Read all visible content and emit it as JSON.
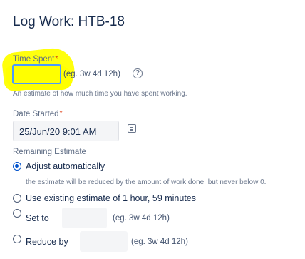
{
  "dialog": {
    "title": "Log Work: HTB-18"
  },
  "time_spent": {
    "label": "Time Spent",
    "required_mark": "*",
    "value": "",
    "hint": "(eg. 3w 4d 12h)",
    "help_glyph": "?",
    "description": "An estimate of how much time you have spent working."
  },
  "date_started": {
    "label": "Date Started",
    "required_mark": "*",
    "value": "25/Jun/20 9:01 AM"
  },
  "remaining_estimate": {
    "label": "Remaining Estimate",
    "options": [
      {
        "label": "Adjust automatically",
        "checked": true
      },
      {
        "label": "Use existing estimate of 1 hour, 59 minutes",
        "checked": false
      },
      {
        "label": "Set to",
        "checked": false,
        "hint": "(eg. 3w 4d 12h)"
      },
      {
        "label": "Reduce by",
        "checked": false,
        "hint": "(eg. 3w 4d 12h)"
      }
    ],
    "auto_description": "the estimate will be reduced by the amount of work done, but never below 0."
  },
  "colors": {
    "highlight": "#ffff00",
    "focus_border": "#4c9aff",
    "radio_selected": "#0052cc",
    "required": "#de350b"
  }
}
